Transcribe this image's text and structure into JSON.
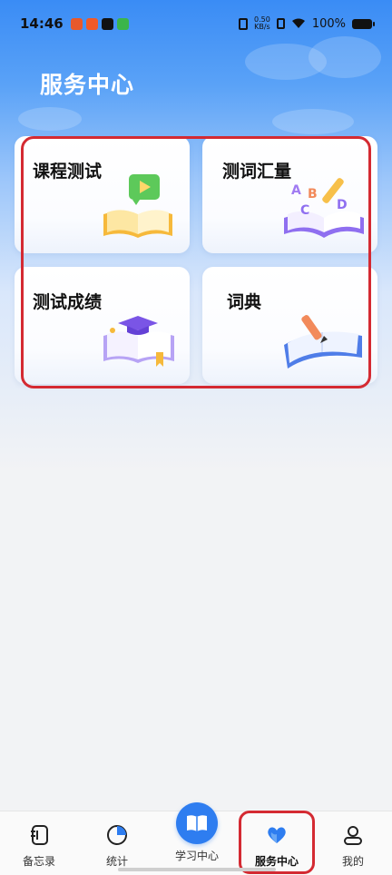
{
  "status_bar": {
    "time": "14:46",
    "net_speed_value": "0.50",
    "net_speed_unit": "KB/s",
    "battery": "100%"
  },
  "header": {
    "title": "服务中心"
  },
  "cards": [
    {
      "label": "课程测试",
      "icon": "video-book-icon"
    },
    {
      "label": "测词汇量",
      "icon": "abcd-letters-book-icon"
    },
    {
      "label": "测试成绩",
      "icon": "graduation-cap-book-icon"
    },
    {
      "label": "词典",
      "icon": "pencil-book-icon"
    }
  ],
  "bottom_nav": {
    "items": [
      {
        "label": "备忘录",
        "icon": "memo-icon"
      },
      {
        "label": "统计",
        "icon": "pie-chart-icon"
      },
      {
        "label": "学习中心",
        "icon": "open-book-icon"
      },
      {
        "label": "服务中心",
        "icon": "heart-icon",
        "active": true
      },
      {
        "label": "我的",
        "icon": "user-icon"
      }
    ]
  },
  "colors": {
    "accent": "#2e7df0",
    "annotation": "#d42a32"
  }
}
